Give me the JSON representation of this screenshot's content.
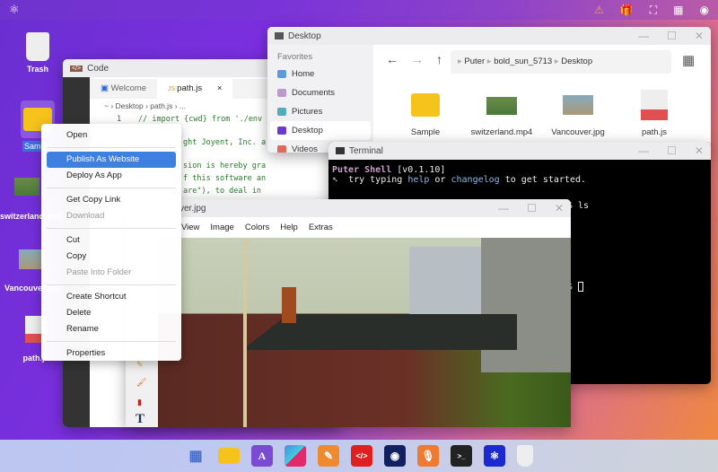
{
  "desktop": {
    "icons": [
      {
        "label": "Trash",
        "icon": "trash-icon"
      },
      {
        "label": "Sample",
        "icon": "folder-icon"
      },
      {
        "label": "switzerland.mp4",
        "icon": "video-icon"
      },
      {
        "label": "Vancouver.jpg",
        "icon": "image-icon"
      },
      {
        "label": "path.js",
        "icon": "js-file-icon"
      }
    ]
  },
  "topbar": {
    "icons": [
      "puter-logo",
      "warning-icon",
      "gift-icon",
      "fullscreen-icon",
      "qr-icon",
      "user-icon"
    ],
    "warning_color": "#f2b01e"
  },
  "code": {
    "title": "Code",
    "tabs": [
      {
        "label": "Welcome"
      },
      {
        "label": "path.js"
      }
    ],
    "breadcrumb": [
      "~",
      "Desktop",
      "path.js",
      "..."
    ],
    "line_number": "1",
    "lines": [
      "// import {cwd} from './env",
      "ght Joyent, Inc. a",
      "sion is hereby gra",
      "f this software an",
      "are\"), to deal in"
    ]
  },
  "explorer": {
    "title": "Desktop",
    "favorites_label": "Favorites",
    "sidebar": [
      {
        "label": "Home"
      },
      {
        "label": "Documents"
      },
      {
        "label": "Pictures"
      },
      {
        "label": "Desktop"
      },
      {
        "label": "Videos"
      }
    ],
    "path": [
      "Puter",
      "bold_sun_5713",
      "Desktop"
    ],
    "files": [
      {
        "label": "Sample"
      },
      {
        "label": "switzerland.mp4"
      },
      {
        "label": "Vancouver.jpg"
      },
      {
        "label": "path.js"
      }
    ]
  },
  "terminal": {
    "title": "Terminal",
    "line1_name": "Puter Shell",
    "line1_ver": " [v0.1.10]",
    "line2_a": "  try typing ",
    "help": "help",
    "or": " or ",
    "changelog": "changelog",
    "line2_b": " to get started.",
    "prompt1": "$ ls",
    "prompt2": "$ "
  },
  "paint": {
    "title": "ver.jpg",
    "menu": [
      "View",
      "Image",
      "Colors",
      "Help",
      "Extras"
    ]
  },
  "context_menu": {
    "items": [
      {
        "label": "Open"
      },
      {
        "label": "Publish As Website"
      },
      {
        "label": "Deploy As App"
      },
      {
        "label": "Get Copy Link"
      },
      {
        "label": "Download"
      },
      {
        "label": "Cut"
      },
      {
        "label": "Copy"
      },
      {
        "label": "Paste Into Folder"
      },
      {
        "label": "Create Shortcut"
      },
      {
        "label": "Delete"
      },
      {
        "label": "Rename"
      },
      {
        "label": "Properties"
      }
    ],
    "selected": "Publish As Website",
    "accent": "#3d80e0"
  },
  "dock": {
    "apps": [
      "app-grid-icon",
      "files-icon",
      "editor-icon",
      "cubes-icon",
      "paint-icon",
      "code-icon",
      "camera-icon",
      "recorder-icon",
      "terminal-icon",
      "puter-icon",
      "trash-icon"
    ]
  }
}
